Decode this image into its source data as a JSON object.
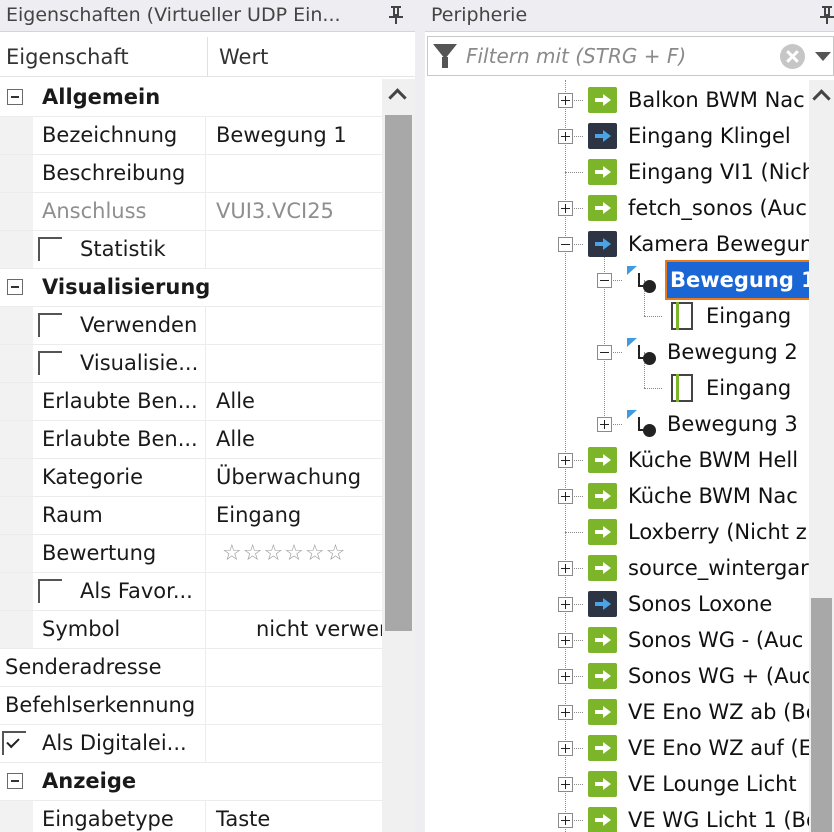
{
  "left_panel": {
    "title": "Eigenschaften (Virtueller UDP Ein...",
    "columns": {
      "name": "Eigenschaft",
      "value": "Wert"
    },
    "rows": [
      {
        "kind": "category",
        "label": "Allgemein"
      },
      {
        "kind": "prop",
        "name": "Bezeichnung",
        "value": "Bewegung 1"
      },
      {
        "kind": "prop",
        "name": "Beschreibung",
        "value": ""
      },
      {
        "kind": "prop",
        "name": "Anschluss",
        "value": "VUI3.VCI25",
        "disabled": true
      },
      {
        "kind": "checkbox",
        "name": "Statistik",
        "checked": false
      },
      {
        "kind": "category",
        "label": "Visualisierung"
      },
      {
        "kind": "checkbox",
        "name": "Verwenden",
        "checked": false
      },
      {
        "kind": "checkbox",
        "name": "Visualisie...",
        "checked": false
      },
      {
        "kind": "prop",
        "name": "Erlaubte Ben...",
        "value": "Alle"
      },
      {
        "kind": "prop",
        "name": "Erlaubte Ben...",
        "value": "Alle"
      },
      {
        "kind": "prop",
        "name": "Kategorie",
        "value": "Überwachung"
      },
      {
        "kind": "prop",
        "name": "Raum",
        "value": "Eingang"
      },
      {
        "kind": "rating",
        "name": "Bewertung",
        "value": 0,
        "max": 6
      },
      {
        "kind": "checkbox",
        "name": "Als Favor...",
        "checked": false
      },
      {
        "kind": "prop",
        "name": "Symbol",
        "value": "nicht verwer"
      },
      {
        "kind": "prop-top",
        "name": "Senderadresse",
        "value": ""
      },
      {
        "kind": "prop-top",
        "name": "Befehlserkennung",
        "value": ""
      },
      {
        "kind": "checkbox-top",
        "name": "Als Digitalei...",
        "checked": true
      },
      {
        "kind": "category",
        "label": "Anzeige"
      },
      {
        "kind": "prop",
        "name": "Eingabetype",
        "value": "Taste"
      }
    ]
  },
  "right_panel": {
    "title": "Peripherie",
    "filter": {
      "placeholder": "Filtern mit (STRG + F)",
      "value": ""
    },
    "tree": [
      {
        "depth": 0,
        "expander": "plus",
        "icon": "green",
        "label": "Balkon BWM Nac"
      },
      {
        "depth": 0,
        "expander": "plus",
        "icon": "dark",
        "label": "Eingang Klingel"
      },
      {
        "depth": 0,
        "expander": "none",
        "icon": "green",
        "label": "Eingang VI1 (Nich"
      },
      {
        "depth": 0,
        "expander": "plus",
        "icon": "green",
        "label": "fetch_sonos (Auc"
      },
      {
        "depth": 0,
        "expander": "minus",
        "icon": "dark",
        "label": "Kamera Bewegun"
      },
      {
        "depth": 1,
        "expander": "minus",
        "icon": "motion",
        "label": "Bewegung 1",
        "selected": true
      },
      {
        "depth": 2,
        "expander": "none",
        "icon": "doc",
        "label": "Eingang"
      },
      {
        "depth": 1,
        "expander": "minus",
        "icon": "motion",
        "label": "Bewegung 2"
      },
      {
        "depth": 2,
        "expander": "none",
        "icon": "doc",
        "label": "Eingang"
      },
      {
        "depth": 1,
        "expander": "plus",
        "icon": "motion",
        "label": "Bewegung 3"
      },
      {
        "depth": 0,
        "expander": "plus",
        "icon": "green",
        "label": "Küche BWM Hell"
      },
      {
        "depth": 0,
        "expander": "plus",
        "icon": "green",
        "label": "Küche BWM Nac"
      },
      {
        "depth": 0,
        "expander": "none",
        "icon": "green",
        "label": "Loxberry (Nicht z"
      },
      {
        "depth": 0,
        "expander": "plus",
        "icon": "green",
        "label": "source_wintergar"
      },
      {
        "depth": 0,
        "expander": "plus",
        "icon": "dark",
        "label": "Sonos Loxone"
      },
      {
        "depth": 0,
        "expander": "plus",
        "icon": "green",
        "label": "Sonos WG - (Auc"
      },
      {
        "depth": 0,
        "expander": "plus",
        "icon": "green",
        "label": "Sonos WG + (Auc"
      },
      {
        "depth": 0,
        "expander": "plus",
        "icon": "green",
        "label": "VE Eno WZ ab (Bo"
      },
      {
        "depth": 0,
        "expander": "plus",
        "icon": "green",
        "label": "VE Eno WZ auf (E"
      },
      {
        "depth": 0,
        "expander": "plus",
        "icon": "green",
        "label": "VE Lounge Licht"
      },
      {
        "depth": 0,
        "expander": "plus",
        "icon": "green",
        "label": "VE WG Licht 1 (Bo"
      }
    ]
  },
  "colors": {
    "selection": "#1a66d4",
    "selection_outline": "#e87a1a",
    "device_green": "#7cb52a",
    "device_dark": "#2d3443",
    "motion_blue": "#3e9be3"
  }
}
